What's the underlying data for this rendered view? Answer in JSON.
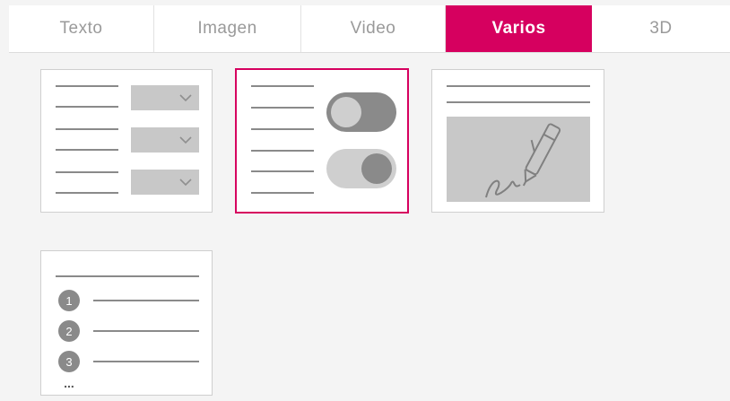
{
  "tabs": [
    {
      "label": "Texto",
      "active": false
    },
    {
      "label": "Imagen",
      "active": false
    },
    {
      "label": "Video",
      "active": false
    },
    {
      "label": "Varios",
      "active": true
    },
    {
      "label": "3D",
      "active": false
    }
  ],
  "accent_color": "#d6005f",
  "cards": [
    {
      "id": "dropdown-fields",
      "icon": "form-dropdowns-icon",
      "selected": false
    },
    {
      "id": "toggle-switches",
      "icon": "toggle-switches-icon",
      "selected": true
    },
    {
      "id": "signature",
      "icon": "signature-pen-icon",
      "selected": false
    },
    {
      "id": "numbered-list",
      "icon": "numbered-list-icon",
      "selected": false,
      "numbers": [
        "1",
        "2",
        "3"
      ],
      "ellipsis": "..."
    }
  ]
}
